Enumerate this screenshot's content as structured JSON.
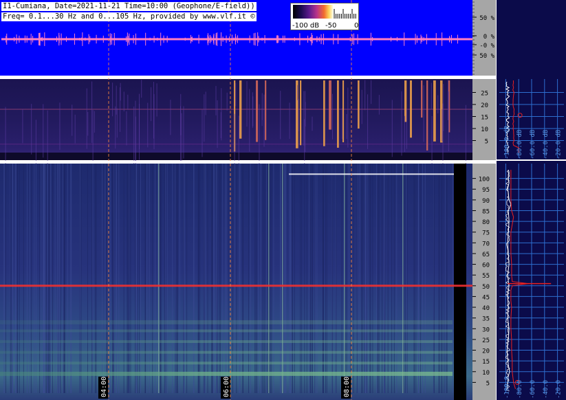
{
  "header": {
    "line1": "I1-Cumiana, Date=2021-11-21 Time=10:00 (Geophone/E-field))",
    "line2": "Freq= 0.1...30 Hz and 0...105 Hz, provided by www.vlf.it ©"
  },
  "colorbar": {
    "labels": [
      "-100 dB",
      "-50",
      "0"
    ],
    "colors": [
      "#000000",
      "#1a0b4e",
      "#5a1a8c",
      "#b8348a",
      "#f26d2e",
      "#fbd25a",
      "#fffbe0"
    ]
  },
  "colors": {
    "background": "#ffffff",
    "waveform_bg": "#0000ff",
    "axis_panel": "#a6a6a6",
    "spectrum_panel": "#0b0b4a",
    "spectrum_grid": "#2e6fd0",
    "spectrum_text": "#5a9ae8",
    "trace_white": "#ffffff",
    "trace_red": "#e82020",
    "signal_red": "#f03030",
    "time_marker": "#ff8a3d"
  },
  "chart_data": [
    {
      "type": "line",
      "title": "",
      "description_axis": "amplitude",
      "xlabel": "",
      "ylabel": "",
      "yticks": [
        "50 %",
        "0 %",
        "-0 %",
        "50 %"
      ],
      "ylim": [
        -100,
        100
      ]
    },
    {
      "type": "heatmap",
      "title": "",
      "xlabel": "",
      "ylabel": "",
      "ylim": [
        0,
        30
      ],
      "yticks": [
        5,
        10,
        15,
        20,
        25
      ],
      "series": [
        {
          "name": "",
          "values": [
            [
              2.2,
              18
            ],
            [
              12.5,
              18
            ]
          ]
        }
      ]
    },
    {
      "type": "heatmap",
      "title": "",
      "xlabel": "",
      "ylabel": "",
      "ylim": [
        0,
        105
      ],
      "yticks": [
        5,
        10,
        15,
        20,
        25,
        30,
        35,
        40,
        45,
        50,
        55,
        60,
        65,
        70,
        75,
        80,
        85,
        90,
        95,
        100
      ],
      "x_tick_labels": [
        "04:00",
        "06:00",
        "08:00"
      ],
      "highlighted_lines": [
        {
          "freq_hz": 50,
          "color": "#f03030"
        },
        {
          "freq_hz": 102,
          "color": "#ffffff"
        }
      ]
    },
    {
      "type": "line",
      "title": "",
      "xlabel": "",
      "ylabel": "",
      "x_tick_labels": [
        "-100.0 dB",
        "-80.0 dB",
        "-60.0 dB",
        "-40.0 dB",
        "-20.0 dB"
      ],
      "x_tick_labels_lower": [
        "-100.0",
        "-80.0",
        "-60.0",
        "-40.0",
        "-20.0"
      ],
      "xlim": [
        -110,
        -10
      ],
      "ylim": [
        0,
        105
      ],
      "series": [
        {
          "name": "",
          "x": [
            -98,
            -97,
            -96,
            -94,
            -96,
            -97,
            -98,
            -96,
            -95,
            -97,
            -96,
            -97,
            -96,
            -95,
            -96,
            -97,
            -95,
            -96,
            -97,
            -96,
            -95,
            -96,
            -92,
            -95,
            -96,
            -97,
            -95,
            -96,
            -96,
            -95,
            -96
          ],
          "y": [
            2,
            5,
            8,
            10,
            13,
            16,
            20,
            25,
            30,
            35,
            40,
            45,
            48,
            50,
            52,
            55,
            60,
            65,
            70,
            75,
            80,
            85,
            88,
            90,
            93,
            95,
            98,
            100,
            102,
            103,
            104
          ]
        },
        {
          "name": "",
          "x": [
            -85,
            -88,
            -90,
            -90,
            -91,
            -91,
            -92,
            -92,
            -91,
            -92,
            -92,
            -92,
            -90,
            -65,
            -90,
            -91,
            -91,
            -92,
            -92,
            -92,
            -88,
            -91,
            -92,
            -92,
            -92,
            -92,
            -92,
            -92
          ],
          "y": [
            2,
            5,
            10,
            15,
            20,
            25,
            30,
            35,
            40,
            43,
            45,
            48,
            50,
            51,
            52,
            55,
            60,
            65,
            70,
            75,
            82,
            85,
            90,
            95,
            98,
            100,
            102,
            104
          ]
        }
      ]
    }
  ]
}
